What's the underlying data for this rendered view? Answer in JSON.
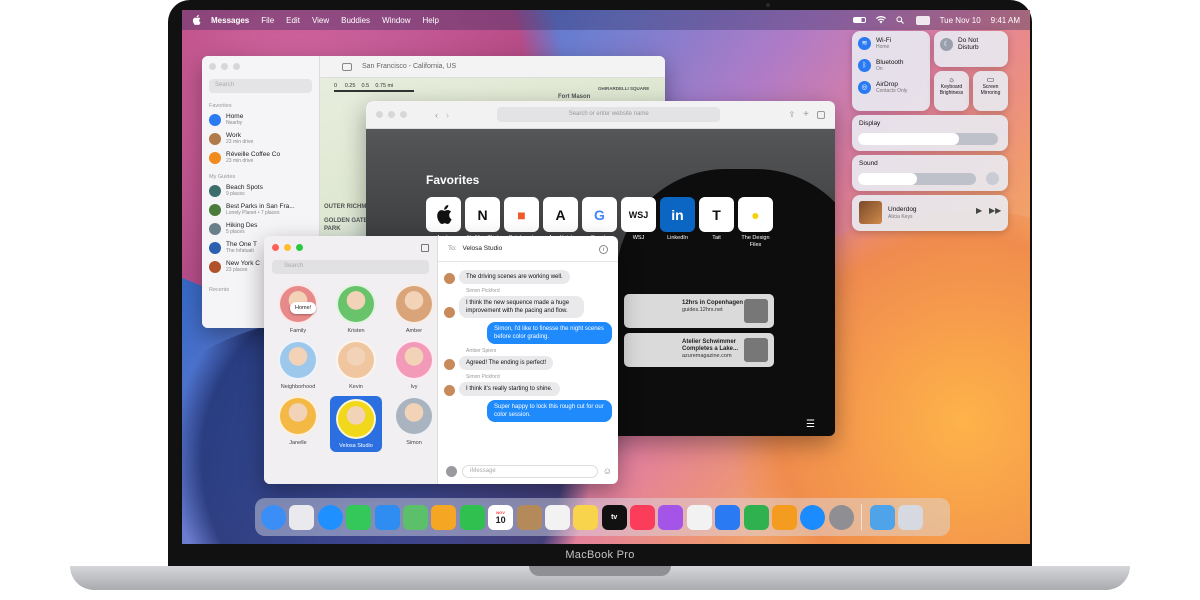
{
  "menubar": {
    "app": "Messages",
    "items": [
      "File",
      "Edit",
      "View",
      "Buddies",
      "Window",
      "Help"
    ],
    "date": "Tue Nov 10",
    "time": "9:41 AM"
  },
  "maps": {
    "title": "San Francisco - California, US",
    "search_placeholder": "Search",
    "favorites_header": "Favorites",
    "favorites": [
      {
        "name": "Home",
        "sub": "Nearby",
        "color": "#2a7af3"
      },
      {
        "name": "Work",
        "sub": "23 min drive",
        "color": "#b07a4a"
      },
      {
        "name": "Réveille Coffee Co",
        "sub": "23 min drive",
        "color": "#f28a1d"
      }
    ],
    "guides_header": "My Guides",
    "guides": [
      {
        "name": "Beach Spots",
        "sub": "9 places",
        "color": "#3b6d6a"
      },
      {
        "name": "Best Parks in San Fra...",
        "sub": "Lonely Planet • 7 places",
        "color": "#4b7b3a"
      },
      {
        "name": "Hiking Des",
        "sub": "5 places",
        "color": "#6b7f8b"
      },
      {
        "name": "The One T",
        "sub": "The Infatuati",
        "color": "#2b5fb0"
      },
      {
        "name": "New York C",
        "sub": "23 places",
        "color": "#b0512b"
      }
    ],
    "recents_header": "Recents",
    "scale": [
      "0",
      "0.25",
      "0.5",
      "0.75 mi"
    ],
    "labels": [
      "Fort Mason",
      "GHIRARDELLI SQUARE",
      "OUTER RICHMOND",
      "GOLDEN GATE",
      "PARK"
    ]
  },
  "safari": {
    "url_placeholder": "Search or enter website name",
    "favorites_title": "Favorites",
    "tiles": [
      {
        "label": "Apple",
        "glyph": "",
        "bg": "#ffffff",
        "fg": "#111111"
      },
      {
        "label": "It's Nice That",
        "glyph": "N",
        "bg": "#ffffff",
        "fg": "#111111"
      },
      {
        "label": "Patchwork Architecture",
        "glyph": "■",
        "bg": "#ffffff",
        "fg": "#f05a28"
      },
      {
        "label": "Ace Hotel",
        "glyph": "A",
        "bg": "#ffffff",
        "fg": "#111111"
      },
      {
        "label": "Google",
        "glyph": "G",
        "bg": "#ffffff",
        "fg": "#4285f4"
      },
      {
        "label": "WSJ",
        "glyph": "WSJ",
        "bg": "#ffffff",
        "fg": "#111111"
      },
      {
        "label": "LinkedIn",
        "glyph": "in",
        "bg": "#0a66c2",
        "fg": "#ffffff"
      },
      {
        "label": "Tait",
        "glyph": "T",
        "bg": "#ffffff",
        "fg": "#111111"
      },
      {
        "label": "The Design Files",
        "glyph": "●",
        "bg": "#ffffff",
        "fg": "#f6d10a"
      }
    ],
    "cards": [
      {
        "title": "12hrs in Copenhagen",
        "sub": "guides.12hrs.net"
      },
      {
        "title": "Atelier Schwimmer Completes a Lake...",
        "sub": "azuremagazine.com"
      }
    ]
  },
  "messages": {
    "search_placeholder": "Search",
    "home_bubble": "Home!",
    "pins": [
      {
        "name": "Family",
        "color": "#e88a8a",
        "selected": false
      },
      {
        "name": "Kristen",
        "color": "#68c36a",
        "selected": false
      },
      {
        "name": "Amber",
        "color": "#d9a47a",
        "selected": false
      },
      {
        "name": "Neighborhood",
        "color": "#9ec7ec",
        "selected": false
      },
      {
        "name": "Kevin",
        "color": "#f0c6a0",
        "selected": false
      },
      {
        "name": "Ivy",
        "color": "#f29ab8",
        "selected": false
      },
      {
        "name": "Janelle",
        "color": "#f4b844",
        "selected": false
      },
      {
        "name": "Velosa Studio",
        "color": "#f1d81a",
        "selected": true
      },
      {
        "name": "Simon",
        "color": "#a9b4c0",
        "selected": false
      }
    ],
    "to_label": "To:",
    "to_name": "Velosa Studio",
    "thread": [
      {
        "from": "",
        "text": "The driving scenes are working well.",
        "me": false
      },
      {
        "from": "Simon Pickford",
        "text": "I think the new sequence made a huge improvement with the pacing and flow.",
        "me": false
      },
      {
        "from": "",
        "text": "Simon, I'd like to finesse the night scenes before color grading.",
        "me": true
      },
      {
        "from": "Amber Spiers",
        "text": "Agreed! The ending is perfect!",
        "me": false
      },
      {
        "from": "Simon Pickford",
        "text": "I think it's really starting to shine.",
        "me": false
      },
      {
        "from": "",
        "text": "Super happy to lock this rough cut for our color session.",
        "me": true
      }
    ],
    "compose_placeholder": "iMessage"
  },
  "control_center": {
    "wifi": {
      "label": "Wi-Fi",
      "sub": "Home"
    },
    "bluetooth": {
      "label": "Bluetooth",
      "sub": "On"
    },
    "airdrop": {
      "label": "AirDrop",
      "sub": "Contacts Only"
    },
    "dnd": "Do Not Disturb",
    "keyboard": "Keyboard Brightness",
    "mirroring": "Screen Mirroring",
    "display_label": "Display",
    "display_level": 0.72,
    "sound_label": "Sound",
    "sound_level": 0.5,
    "now_playing_title": "Underdog",
    "now_playing_artist": "Alicia Keys"
  },
  "dock": [
    {
      "name": "finder-icon",
      "color": "#3a8ef6"
    },
    {
      "name": "launchpad-icon",
      "color": "#e9e9ee"
    },
    {
      "name": "safari-icon",
      "color": "#1e90ff"
    },
    {
      "name": "messages-icon",
      "color": "#34c759"
    },
    {
      "name": "mail-icon",
      "color": "#2f8cf0"
    },
    {
      "name": "maps-icon",
      "color": "#5cbf6a"
    },
    {
      "name": "photos-icon",
      "color": "#f5a623"
    },
    {
      "name": "facetime-icon",
      "color": "#30c04f"
    },
    {
      "name": "calendar-icon",
      "color": "#ffffff"
    },
    {
      "name": "contacts-icon",
      "color": "#b58a5b"
    },
    {
      "name": "reminders-icon",
      "color": "#f2f2f2"
    },
    {
      "name": "notes-icon",
      "color": "#f7d44c"
    },
    {
      "name": "tv-icon",
      "color": "#111111"
    },
    {
      "name": "music-icon",
      "color": "#fb3c5a"
    },
    {
      "name": "podcasts-icon",
      "color": "#a454e6"
    },
    {
      "name": "news-icon",
      "color": "#f2f2f2"
    },
    {
      "name": "keynote-icon",
      "color": "#2a7af3"
    },
    {
      "name": "numbers-icon",
      "color": "#2fb14f"
    },
    {
      "name": "pages-icon",
      "color": "#f39c1f"
    },
    {
      "name": "app-store-icon",
      "color": "#1a8cff"
    },
    {
      "name": "system-preferences-icon",
      "color": "#8e8e93"
    },
    {
      "name": "downloads-folder-icon",
      "color": "#4fa3e8"
    },
    {
      "name": "trash-icon",
      "color": "#d6d9df"
    }
  ],
  "dock_calendar_day": "10",
  "dock_calendar_month": "NOV",
  "dock_tv_label": "tv",
  "device_label": "MacBook Pro"
}
